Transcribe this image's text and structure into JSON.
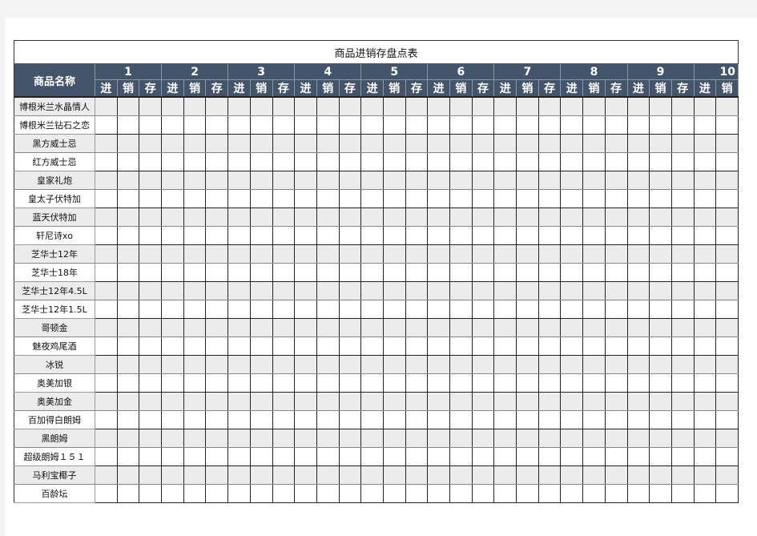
{
  "title": "商品进销存盘点表",
  "header": {
    "name_label": "商品名称",
    "days": [
      "1",
      "2",
      "3",
      "4",
      "5",
      "6",
      "7",
      "8",
      "9",
      "10"
    ],
    "sub_labels": [
      "进",
      "销",
      "存"
    ],
    "visible_sub_columns": 29
  },
  "colors": {
    "header_bg": "#44546a",
    "header_text": "#ffffff",
    "shaded_row": "#ececec",
    "page_bg": "#f3f3f3"
  },
  "products": [
    "博根米兰水晶情人",
    "博根米兰钻石之恋",
    "黑方威士忌",
    "红方威士忌",
    "皇家礼炮",
    "皇太子伏特加",
    "蓝天伏特加",
    "轩尼诗xo",
    "芝华士12年",
    "芝华士18年",
    "芝华士12年4.5L",
    "芝华士12年1.5L",
    "哥顿金",
    "魅夜鸡尾酒",
    "冰锐",
    "奥美加银",
    "奥美加金",
    "百加得白朗姆",
    "黑朗姆",
    "超级朗姆１５１",
    "马利宝椰子",
    "百龄坛"
  ]
}
